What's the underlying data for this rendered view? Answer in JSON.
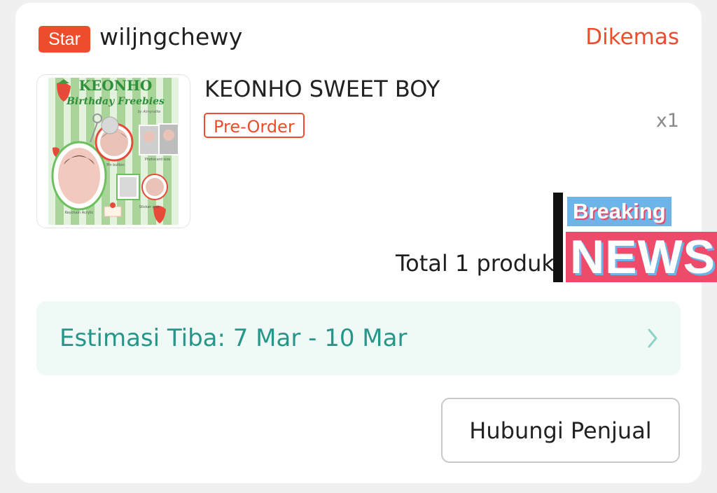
{
  "order": {
    "badge": "Star",
    "shop_name": "wiljngchewy",
    "status": "Dikemas",
    "status_color": "#ee4d2d",
    "product": {
      "title": "KEONHO SWEET BOY",
      "tag": "Pre-Order",
      "quantity": "x1",
      "thumbnail": {
        "title": "KEONHO",
        "subtitle": "Birthday Freebies",
        "credit": "by Almyrallie",
        "items": [
          "Pin button",
          "Photocard size",
          "Keychain Acrylic",
          "Sticker size"
        ]
      }
    },
    "total": "Total 1 produk:",
    "eta": {
      "label": "Estimasi Tiba: 7 Mar - 10 Mar",
      "icon": "chevron-right-icon",
      "color": "#26968a"
    },
    "contact_button": "Hubungi Penjual"
  },
  "overlay": {
    "breaking": "Breaking",
    "news": "NEWS"
  }
}
